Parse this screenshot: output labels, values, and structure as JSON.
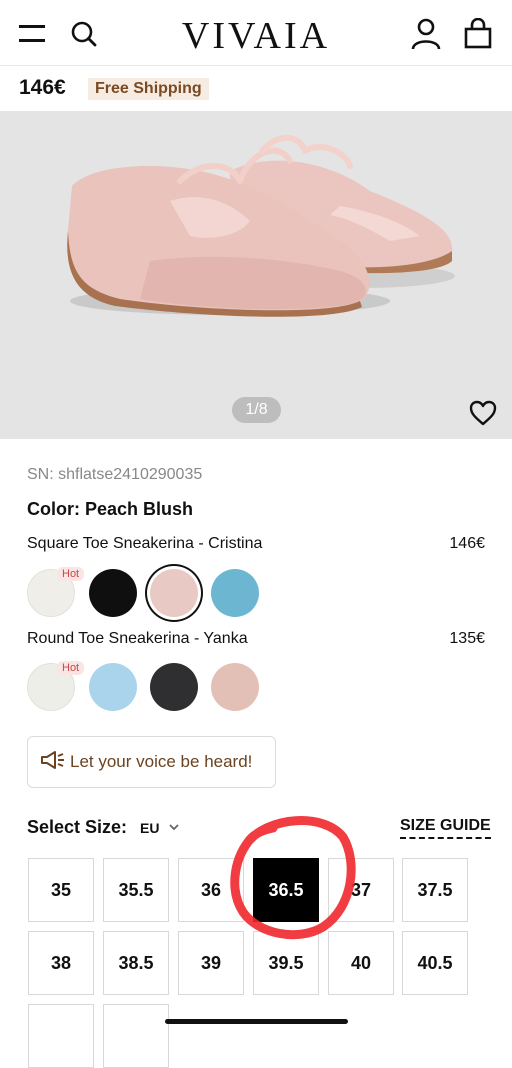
{
  "header": {
    "logo": "VIVAIA",
    "menu_icon": "menu-icon",
    "search_icon": "search-icon",
    "account_icon": "account-icon",
    "bag_icon": "bag-icon"
  },
  "price_bar": {
    "price": "146€",
    "shipping": "Free Shipping"
  },
  "gallery": {
    "counter": "1/8",
    "wishlist_icon": "heart-icon"
  },
  "product": {
    "sn": "SN: shflatse2410290035",
    "color": "Color: Peach Blush"
  },
  "variants": [
    {
      "name": "Square Toe Sneakerina - Cristina",
      "price": "146€",
      "swatches": [
        {
          "color": "#efeee8",
          "hot": "Hot",
          "selected": false
        },
        {
          "color": "#0f0f10",
          "hot": "",
          "selected": false
        },
        {
          "color": "#e8c9c3",
          "hot": "",
          "selected": true
        },
        {
          "color": "#6cb6d2",
          "hot": "",
          "selected": false
        }
      ]
    },
    {
      "name": "Round Toe Sneakerina - Yanka",
      "price": "135€",
      "swatches": [
        {
          "color": "#eeeee9",
          "hot": "Hot",
          "selected": false
        },
        {
          "color": "#a9d4ec",
          "hot": "",
          "selected": false
        },
        {
          "color": "#2f2f31",
          "hot": "",
          "selected": false
        },
        {
          "color": "#e2c0b6",
          "hot": "",
          "selected": false
        }
      ]
    }
  ],
  "feedback": {
    "label": "Let your voice be heard!",
    "icon": "megaphone-icon"
  },
  "size_select": {
    "label": "Select Size:",
    "system": "EU",
    "guide": "SIZE GUIDE",
    "sizes": [
      "35",
      "35.5",
      "36",
      "36.5",
      "37",
      "37.5",
      "38",
      "38.5",
      "39",
      "39.5",
      "40",
      "40.5"
    ],
    "selected": "36.5"
  },
  "colors": {
    "accent_brown": "#6b4321",
    "annotation_red": "#f0282e",
    "selected_size_bg": "#000000"
  }
}
